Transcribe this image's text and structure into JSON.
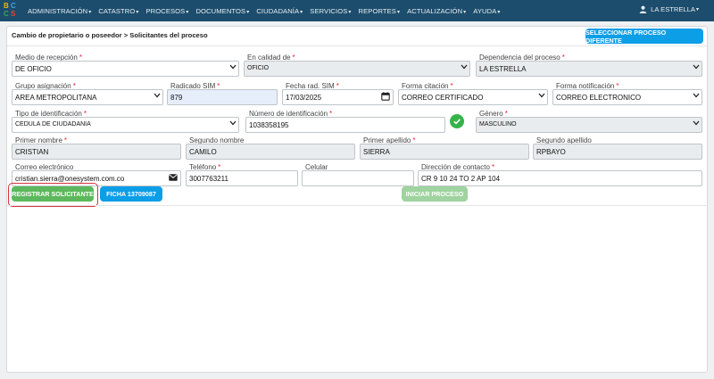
{
  "nav": {
    "logo_letters": [
      "B",
      "C",
      "C",
      "S"
    ],
    "items": [
      {
        "label": "ADMINISTRACIÓN"
      },
      {
        "label": "CATASTRO"
      },
      {
        "label": "PROCESOS"
      },
      {
        "label": "DOCUMENTOS"
      },
      {
        "label": "CIUDADANÍA"
      },
      {
        "label": "SERVICIOS"
      },
      {
        "label": "REPORTES"
      },
      {
        "label": "ACTUALIZACIÓN"
      },
      {
        "label": "AYUDA"
      }
    ],
    "user": "LA ESTRELLA",
    "user_icon": "user-icon"
  },
  "header": {
    "breadcrumb": "Cambio de propietario o poseedor > Solicitantes del proceso",
    "select_button": "SELECCIONAR PROCESO DIFERENTE"
  },
  "form": {
    "medio_recepcion": {
      "label": "Medio de recepción",
      "value": "DE OFICIO"
    },
    "calidad": {
      "label": "En calidad de",
      "value": "OFICIO"
    },
    "dependencia": {
      "label": "Dependencia del proceso",
      "value": "LA ESTRELLA"
    },
    "grupo": {
      "label": "Grupo asignación",
      "value": "AREA METROPOLITANA"
    },
    "radicado": {
      "label": "Radicado SIM",
      "value": "879"
    },
    "fecha": {
      "label": "Fecha rad. SIM",
      "value": "17/03/2025"
    },
    "citacion": {
      "label": "Forma citación",
      "value": "CORREO CERTIFICADO"
    },
    "notificacion": {
      "label": "Forma notificación",
      "value": "CORREO ELECTRONICO"
    },
    "tipo_id": {
      "label": "Tipo de identificación",
      "value": "CEDULA DE CIUDADANIA"
    },
    "numero_id": {
      "label": "Número de identificación",
      "value": "1038358195"
    },
    "genero": {
      "label": "Género",
      "value": "MASCULINO"
    },
    "primer_nombre": {
      "label": "Primer nombre",
      "value": "CRISTIAN"
    },
    "segundo_nombre": {
      "label": "Segundo nombre",
      "value": "CAMILO"
    },
    "primer_apellido": {
      "label": "Primer apellido",
      "value": "SIERRA"
    },
    "segundo_apellido": {
      "label": "Segundo apellido",
      "value": "RPBAYO"
    },
    "correo": {
      "label": "Correo electrónico",
      "value": "cristian.sierra@onesystem.com.co"
    },
    "telefono": {
      "label": "Teléfono",
      "value": "3007763211"
    },
    "celular": {
      "label": "Celular",
      "value": ""
    },
    "direccion": {
      "label": "Dirección de contacto",
      "value": "CR 9 10 24 TO 2 AP 104"
    }
  },
  "actions": {
    "registrar": "REGISTRAR SOLICITANTE",
    "ficha": "FICHA 13709087",
    "iniciar": "INICIAR PROCESO"
  },
  "colors": {
    "navbar": "#1d4d6d",
    "primary": "#0d9ee8",
    "success": "#5cb85c",
    "required": "#e23",
    "highlight_border": "#d9323a"
  }
}
